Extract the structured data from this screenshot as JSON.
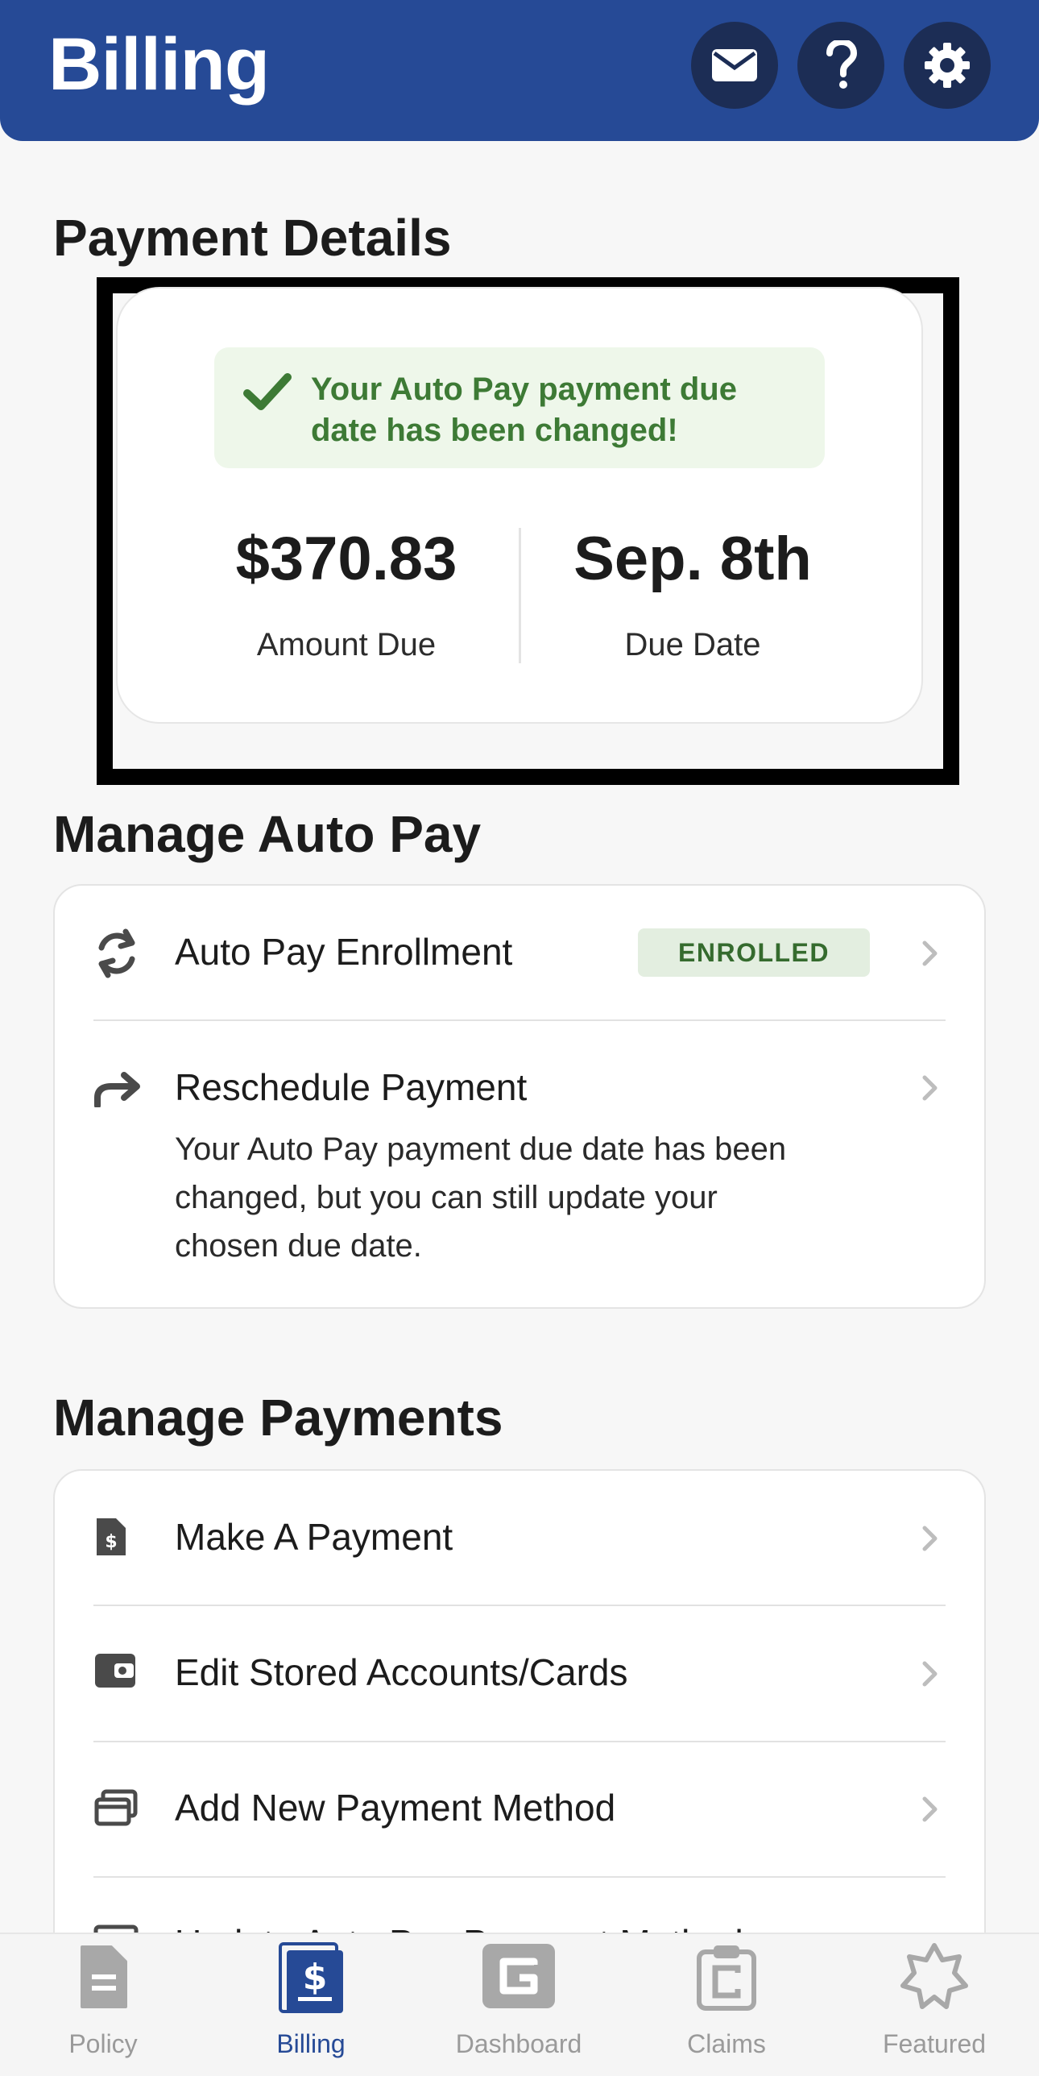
{
  "header": {
    "title": "Billing",
    "icons": [
      "mail-icon",
      "help-icon",
      "settings-icon"
    ]
  },
  "payment_details": {
    "title": "Payment Details",
    "banner_text": "Your Auto Pay payment due date has been changed!",
    "amount_value": "$370.83",
    "amount_label": "Amount Due",
    "date_value": "Sep. 8th",
    "date_label": "Due Date"
  },
  "manage_auto_pay": {
    "title": "Manage Auto Pay",
    "enrollment_label": "Auto Pay Enrollment",
    "enrollment_badge": "ENROLLED",
    "reschedule_label": "Reschedule Payment",
    "reschedule_desc": "Your Auto Pay payment due date has been changed, but you can still update your chosen due date."
  },
  "manage_payments": {
    "title": "Manage Payments",
    "items": [
      {
        "label": "Make A Payment",
        "icon": "payment-doc-icon"
      },
      {
        "label": "Edit Stored Accounts/Cards",
        "icon": "wallet-icon"
      },
      {
        "label": "Add New Payment Method",
        "icon": "cards-icon"
      },
      {
        "label": "Update Auto Pay Payment Method",
        "icon": "card-icon"
      }
    ]
  },
  "bottom_nav": {
    "items": [
      {
        "label": "Policy",
        "icon": "policy-icon",
        "active": false
      },
      {
        "label": "Billing",
        "icon": "billing-icon",
        "active": true
      },
      {
        "label": "Dashboard",
        "icon": "dashboard-icon",
        "active": false
      },
      {
        "label": "Claims",
        "icon": "claims-icon",
        "active": false
      },
      {
        "label": "Featured",
        "icon": "featured-icon",
        "active": false
      }
    ]
  },
  "colors": {
    "brand": "#264a96",
    "success": "#3d7a35",
    "success_bg": "#eef7ea"
  }
}
